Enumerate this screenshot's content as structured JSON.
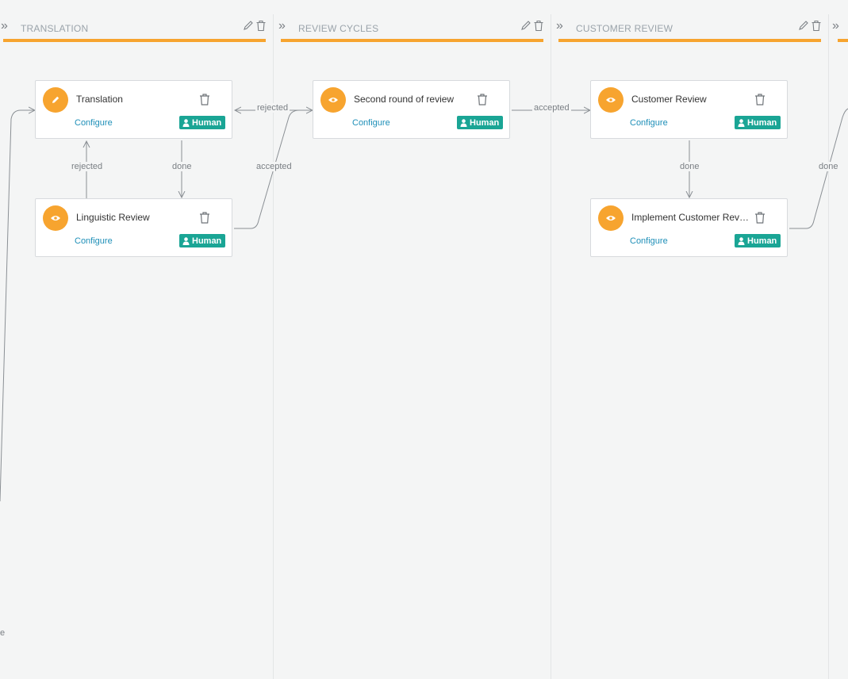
{
  "stages": [
    {
      "title": "TRANSLATION",
      "collapse_icon": "double-chevron-right-icon"
    },
    {
      "title": "REVIEW CYCLES",
      "collapse_icon": "double-chevron-right-icon"
    },
    {
      "title": "CUSTOMER REVIEW",
      "collapse_icon": "double-chevron-right-icon"
    }
  ],
  "cards": [
    {
      "title": "Translation",
      "icon": "pencil-icon",
      "configure": "Configure",
      "badge": "Human"
    },
    {
      "title": "Linguistic Review",
      "icon": "eye-icon",
      "configure": "Configure",
      "badge": "Human"
    },
    {
      "title": "Second round of review",
      "icon": "eye-icon",
      "configure": "Configure",
      "badge": "Human"
    },
    {
      "title": "Customer Review",
      "icon": "eye-icon",
      "configure": "Configure",
      "badge": "Human"
    },
    {
      "title": "Implement Customer Rev…",
      "icon": "eye-icon",
      "configure": "Configure",
      "badge": "Human"
    }
  ],
  "edge_labels": {
    "translation_done": "done",
    "review_rejected": "rejected",
    "second_rejected": "rejected",
    "linguistic_accepted": "accepted",
    "second_accepted": "accepted",
    "customer_done": "done",
    "implement_done": "done",
    "left_partial": "e"
  },
  "colors": {
    "accent": "#f7a42f",
    "badge": "#1aa595",
    "link": "#1e8fb8"
  }
}
